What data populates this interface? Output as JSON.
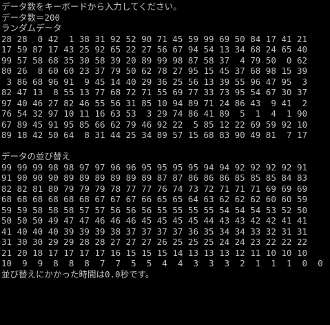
{
  "console": {
    "colors": {
      "background": "#000000",
      "text": "#c0c0c0"
    },
    "prompt_line": "データ数をキーボードから入力してください。",
    "input_line": "データ数＝200",
    "random_header": "ランダムデータ",
    "random_rows": [
      "28 28  0 42  1 38 31 92 52 90 71 45 59 99 69 50 84 17 41 21",
      "17 59 87 17 43 25 92 65 22 27 56 67 94 54 13 34 68 24 65 40",
      "99 57 58 68 35 30 58 39 20 89 99 98 87 58 37  4 79 50  0 62",
      "80 26  8 60 60 23 37 79 50 62 78 27 95 15 45 37 68 98 15 39",
      " 3 86 68 96 91  9 45 14 40 29 36 25 56 13 39 55 96 47 95  3",
      "82 47 13  8 55 13 77 68 72 71 55 69 77 33 73 95 54 67 30 37",
      "97 40 46 27 82 46 55 56 31 85 10 94 89 71 24 86 43  9 41  2",
      "76 54 32 97 10 11 16 63 53  3 29 74 86 41 89  5  1  4  1 90",
      "67 89 45 91 95 85 66 62 79 46 92 22  5 85 12 22 69 59 92 10",
      "89 18 42 50 64  8 31 44 25 34 89 57 15 68 83 90 49 81  7 17"
    ],
    "sorted_header": "データの並び替え",
    "sorted_rows": [
      "99 99 99 98 98 97 97 96 96 95 95 95 95 94 94 92 92 92 92 91",
      "91 90 90 90 89 89 89 89 89 89 87 87 86 86 86 85 85 85 84 83",
      "82 82 81 80 79 79 79 78 77 77 76 74 73 72 71 71 71 69 69 69",
      "68 68 68 68 68 68 67 67 67 66 65 65 64 63 62 62 62 60 60 59",
      "59 59 58 58 58 57 57 56 56 56 55 55 55 55 54 54 54 53 52 50",
      "50 50 50 49 47 47 46 46 46 45 45 45 45 44 43 43 42 42 41 41",
      "41 40 40 40 39 39 39 38 37 37 37 37 36 35 34 34 33 32 31 31",
      "31 30 30 29 29 28 28 27 27 27 26 25 25 25 24 24 23 22 22 22",
      "21 20 18 17 17 17 17 16 15 15 15 14 13 13 13 12 11 10 10 10",
      "10  9  9  8  8  8  7  7  5  5  4  4  3  3  3  2  1  1  1  0  0"
    ],
    "timing_line": "並び替えにかかった時間は0.0秒です。"
  }
}
